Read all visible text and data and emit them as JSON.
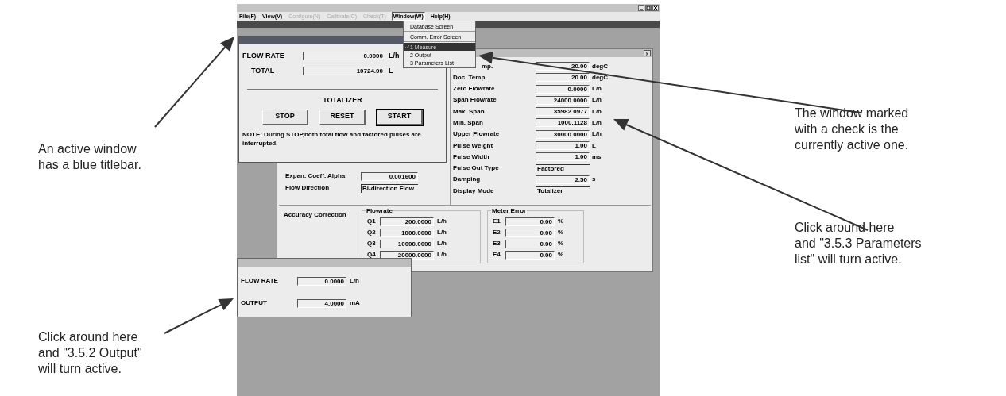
{
  "menu_bar": [
    {
      "label": "File(F)",
      "disabled": false,
      "open": false
    },
    {
      "label": "View(V)",
      "disabled": false,
      "open": false
    },
    {
      "label": "Configure(N)",
      "disabled": true,
      "open": false
    },
    {
      "label": "Calibrate(C)",
      "disabled": true,
      "open": false
    },
    {
      "label": "Check(T)",
      "disabled": true,
      "open": false
    },
    {
      "label": "Window(W)",
      "disabled": false,
      "open": true
    },
    {
      "label": "Help(H)",
      "disabled": false,
      "open": false
    }
  ],
  "window_menu": {
    "groups": [
      [
        {
          "label": "Database Screen",
          "checked": false,
          "selected": false
        }
      ],
      [
        {
          "label": "Comm. Error Screen",
          "checked": false,
          "selected": false
        }
      ],
      [
        {
          "label": "1 Measure",
          "checked": true,
          "selected": true
        },
        {
          "label": "2 Output",
          "checked": false,
          "selected": false
        },
        {
          "label": "3 Parameters List",
          "checked": false,
          "selected": false
        }
      ]
    ]
  },
  "parameters_window": {
    "active": false,
    "close": "x",
    "right_fields": [
      {
        "label": "mp.",
        "value": "20.00",
        "unit": "degC",
        "kind": "number"
      },
      {
        "label": "Doc. Temp.",
        "value": "20.00",
        "unit": "degC",
        "kind": "number"
      },
      {
        "label": "Zero Flowrate",
        "value": "0.0000",
        "unit": "L/h",
        "kind": "number"
      },
      {
        "label": "Span Flowrate",
        "value": "24000.0000",
        "unit": "L/h",
        "kind": "number"
      },
      {
        "label": "Max. Span",
        "value": "35982.0977",
        "unit": "L/h",
        "kind": "number"
      },
      {
        "label": "Min. Span",
        "value": "1000.1128",
        "unit": "L/h",
        "kind": "number"
      },
      {
        "label": "Upper Flowrate",
        "value": "30000.0000",
        "unit": "L/h",
        "kind": "number"
      },
      {
        "label": "Pulse Weight",
        "value": "1.00",
        "unit": "L",
        "kind": "number"
      },
      {
        "label": "Pulse Width",
        "value": "1.00",
        "unit": "ms",
        "kind": "number"
      },
      {
        "label": "Pulse Out Type",
        "value": "Factored",
        "kind": "text"
      },
      {
        "label": "Damping",
        "value": "2.50",
        "unit": "s",
        "kind": "number"
      },
      {
        "label": "Display Mode",
        "value": "Totalizer",
        "kind": "text"
      }
    ],
    "left_fields": [
      {
        "label": "Expan. Coeff. Alpha",
        "value": "0.001600",
        "kind": "number"
      },
      {
        "label": "Flow Direction",
        "value": "Bi-direction Flow",
        "kind": "text"
      }
    ],
    "accuracy_label": "Accuracy Correction",
    "groups": [
      {
        "title": "Flowrate",
        "rows": [
          {
            "label": "Q1",
            "value": "200.0000",
            "unit": "L/h"
          },
          {
            "label": "Q2",
            "value": "1000.0000",
            "unit": "L/h"
          },
          {
            "label": "Q3",
            "value": "10000.0000",
            "unit": "L/h"
          },
          {
            "label": "Q4",
            "value": "20000.0000",
            "unit": "L/h"
          }
        ]
      },
      {
        "title": "Meter Error",
        "rows": [
          {
            "label": "E1",
            "value": "0.00",
            "unit": "%"
          },
          {
            "label": "E2",
            "value": "0.00",
            "unit": "%"
          },
          {
            "label": "E3",
            "value": "0.00",
            "unit": "%"
          },
          {
            "label": "E4",
            "value": "0.00",
            "unit": "%"
          }
        ]
      }
    ]
  },
  "measure_window": {
    "active": true,
    "fields": [
      {
        "label": "FLOW RATE",
        "value": "0.0000",
        "unit": "L/h"
      },
      {
        "label": "TOTAL",
        "value": "10724.00",
        "unit": "L"
      }
    ],
    "section_title": "TOTALIZER",
    "buttons": [
      {
        "label": "STOP",
        "default": false
      },
      {
        "label": "RESET",
        "default": false
      },
      {
        "label": "START",
        "default": true
      }
    ],
    "note": "NOTE: During STOP,both total flow and factored pulses are interrupted."
  },
  "output_window": {
    "active": false,
    "fields": [
      {
        "label": "FLOW RATE",
        "value": "0.0000",
        "unit": "L/h"
      },
      {
        "label": "OUTPUT",
        "value": "4.0000",
        "unit": "mA"
      }
    ]
  },
  "annotations": [
    {
      "lines": [
        "An active window",
        "has a blue titlebar."
      ]
    },
    {
      "lines": [
        "The window marked",
        "with a check is the",
        "currently active one."
      ]
    },
    {
      "lines": [
        "Click around here",
        "and \"3.5.3 Parameters",
        "list\" will turn active."
      ]
    },
    {
      "lines": [
        "Click around here",
        "and \"3.5.2 Output\"",
        "will turn active."
      ]
    }
  ]
}
